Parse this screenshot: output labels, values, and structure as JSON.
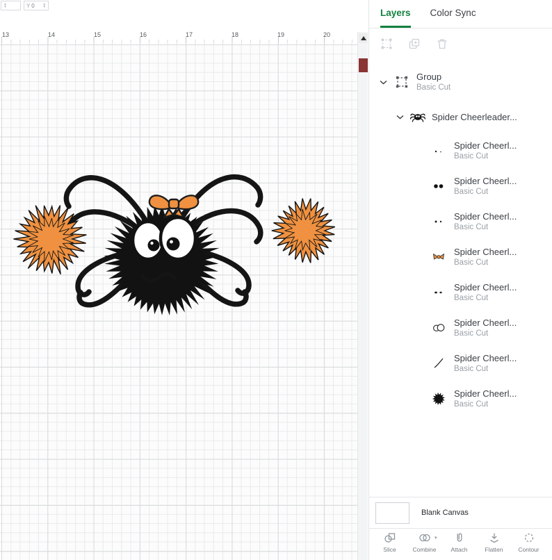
{
  "topbar": {
    "x_value": "",
    "y_label": "Y",
    "y_value": "0"
  },
  "ruler": {
    "numbers": [
      "13",
      "14",
      "15",
      "16",
      "17",
      "18",
      "19",
      "20"
    ]
  },
  "panel": {
    "tabs": [
      {
        "label": "Layers"
      },
      {
        "label": "Color Sync"
      }
    ],
    "group_row": {
      "title": "Group",
      "subtitle": "Basic Cut"
    },
    "parent_row": {
      "title": "Spider Cheerleader..."
    },
    "child_rows": [
      {
        "title": "Spider Cheerl...",
        "subtitle": "Basic Cut",
        "thumb": "tiny-dots"
      },
      {
        "title": "Spider Cheerl...",
        "subtitle": "Basic Cut",
        "thumb": "pupils"
      },
      {
        "title": "Spider Cheerl...",
        "subtitle": "Basic Cut",
        "thumb": "small-dots"
      },
      {
        "title": "Spider Cheerl...",
        "subtitle": "Basic Cut",
        "thumb": "bow"
      },
      {
        "title": "Spider Cheerl...",
        "subtitle": "Basic Cut",
        "thumb": "small-ovals"
      },
      {
        "title": "Spider Cheerl...",
        "subtitle": "Basic Cut",
        "thumb": "eye-outlines"
      },
      {
        "title": "Spider Cheerl...",
        "subtitle": "Basic Cut",
        "thumb": "mouth-curve"
      },
      {
        "title": "Spider Cheerl...",
        "subtitle": "Basic Cut",
        "thumb": "fuzzy-body"
      }
    ],
    "canvas_row": {
      "label": "Blank Canvas"
    },
    "actions": [
      {
        "label": "Slice"
      },
      {
        "label": "Combine"
      },
      {
        "label": "Attach"
      },
      {
        "label": "Flatten"
      },
      {
        "label": "Contour"
      }
    ]
  },
  "colors": {
    "accent_green": "#12813f",
    "artwork_orange": "#ef9140",
    "artwork_black": "#121212",
    "scroll_thumb": "#8a3434"
  }
}
